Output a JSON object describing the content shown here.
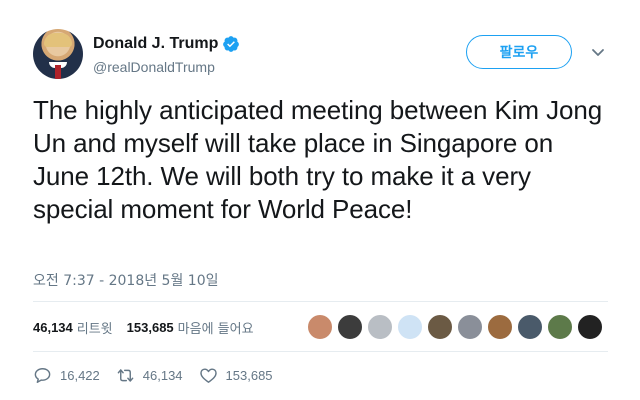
{
  "author": {
    "display_name": "Donald J. Trump",
    "handle": "@realDonaldTrump",
    "verified": true,
    "avatar_icon": "profile-photo"
  },
  "follow_button": {
    "label": "팔로우"
  },
  "menu": {
    "icon": "chevron-down-icon"
  },
  "tweet": {
    "text": "The highly anticipated meeting between Kim Jong Un and myself will take place in Singapore on June 12th. We will both try to make it a very special moment for World Peace!",
    "timestamp": "오전 7:37 - 2018년 5월 10일"
  },
  "stats": {
    "retweets_count": "46,134",
    "retweets_label": "리트윗",
    "likes_count": "153,685",
    "likes_label": "마음에 들어요"
  },
  "likers": {
    "count_shown": 10,
    "colors": [
      "#c98a6b",
      "#3c3c3c",
      "#b9bec4",
      "#cfe3f5",
      "#6b5a44",
      "#8a8f99",
      "#9c6b3f",
      "#4a5a6a",
      "#5d7a4a",
      "#222222"
    ]
  },
  "actions": {
    "reply_count": "16,422",
    "retweet_count": "46,134",
    "like_count": "153,685"
  },
  "colors": {
    "accent": "#1da1f2",
    "text": "#14171a",
    "muted": "#657786",
    "divider": "#e6ecf0"
  }
}
